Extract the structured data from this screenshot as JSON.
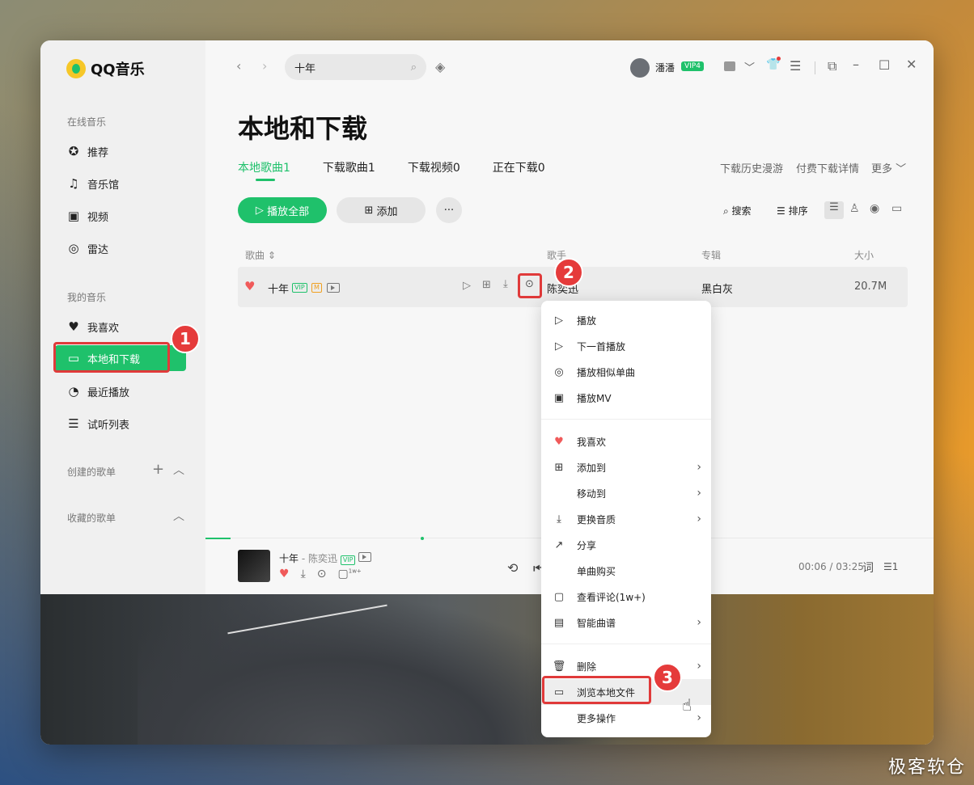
{
  "app": {
    "name": "QQ音乐"
  },
  "sidebar": {
    "online_section": "在线音乐",
    "online_items": [
      {
        "label": "推荐",
        "icon": "star-icon"
      },
      {
        "label": "音乐馆",
        "icon": "music-note-icon"
      },
      {
        "label": "视频",
        "icon": "video-icon"
      },
      {
        "label": "雷达",
        "icon": "radar-icon"
      }
    ],
    "my_section": "我的音乐",
    "my_items": [
      {
        "label": "我喜欢",
        "icon": "heart-icon"
      },
      {
        "label": "本地和下载",
        "icon": "monitor-icon"
      },
      {
        "label": "最近播放",
        "icon": "clock-icon"
      },
      {
        "label": "试听列表",
        "icon": "playlist-icon"
      }
    ],
    "created_playlists": "创建的歌单",
    "collected_playlists": "收藏的歌单"
  },
  "header": {
    "search_value": "十年",
    "username": "潘潘",
    "vip_badge": "VIP4"
  },
  "page": {
    "title": "本地和下载",
    "tabs": [
      {
        "label": "本地歌曲1",
        "active": true
      },
      {
        "label": "下载歌曲1",
        "active": false
      },
      {
        "label": "下载视频0",
        "active": false
      },
      {
        "label": "正在下载0",
        "active": false
      }
    ],
    "right_links": {
      "history": "下载历史漫游",
      "paid": "付费下载详情",
      "more": "更多"
    },
    "play_all": "播放全部",
    "add": "添加",
    "search": "搜索",
    "sort": "排序"
  },
  "table": {
    "headers": {
      "song": "歌曲",
      "singer": "歌手",
      "album": "专辑",
      "size": "大小"
    },
    "rows": [
      {
        "song": "十年",
        "singer": "陈奕迅",
        "album": "黑白灰",
        "size": "20.7M"
      }
    ]
  },
  "context_menu": {
    "items": [
      {
        "label": "播放",
        "icon": "play-icon",
        "submenu": false
      },
      {
        "label": "下一首播放",
        "icon": "play-next-icon",
        "submenu": false
      },
      {
        "label": "播放相似单曲",
        "icon": "similar-icon",
        "submenu": false
      },
      {
        "label": "播放MV",
        "icon": "mv-icon",
        "submenu": false
      },
      {
        "label": "我喜欢",
        "icon": "heart-icon",
        "submenu": false
      },
      {
        "label": "添加到",
        "icon": "plus-box-icon",
        "submenu": true
      },
      {
        "label": "移动到",
        "icon": "",
        "submenu": true
      },
      {
        "label": "更换音质",
        "icon": "download-icon",
        "submenu": true
      },
      {
        "label": "分享",
        "icon": "share-icon",
        "submenu": false
      },
      {
        "label": "单曲购买",
        "icon": "",
        "submenu": false
      },
      {
        "label": "查看评论(1w+)",
        "icon": "comment-icon",
        "submenu": false
      },
      {
        "label": "智能曲谱",
        "icon": "score-icon",
        "submenu": true
      },
      {
        "label": "删除",
        "icon": "trash-icon",
        "submenu": true
      },
      {
        "label": "浏览本地文件",
        "icon": "folder-icon",
        "submenu": false
      },
      {
        "label": "更多操作",
        "icon": "",
        "submenu": true
      }
    ]
  },
  "player": {
    "song": "十年",
    "singer": "- 陈奕迅",
    "time": "00:06 / 03:25",
    "lyrics_btn": "词",
    "queue_count": "1",
    "comment_count": "1w+"
  },
  "annotations": [
    "1",
    "2",
    "3"
  ],
  "watermark": "极客软仓",
  "colors": {
    "accent": "#1fc16b",
    "highlight": "#e03a3a"
  }
}
